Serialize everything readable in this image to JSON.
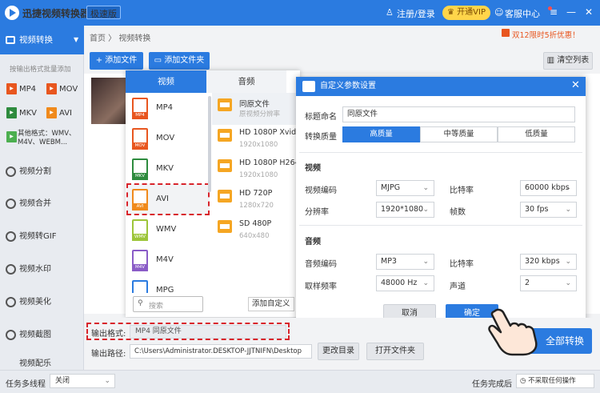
{
  "titlebar": {
    "app_name": "迅捷视频转换器",
    "badge": "极速版",
    "login": "注册/登录",
    "vip": "开通VIP",
    "service": "客服中心",
    "min": "—",
    "menu": "≡",
    "close": "✕"
  },
  "sidebar": {
    "header": "视频转换",
    "subtitle": "按输出格式批量添加",
    "formats": [
      "MP4",
      "MOV",
      "MKV",
      "AVI"
    ],
    "other_line1": "其他格式：WMV、",
    "other_line2": "M4V、WEBM...",
    "items": [
      "视频分割",
      "视频合并",
      "视频转GIF",
      "视频水印",
      "视频美化",
      "视频截图",
      "视频配乐"
    ]
  },
  "main": {
    "breadcrumb": "首页 〉 视频转换",
    "promo": "双12限时5折优惠！",
    "add_file": "添加文件",
    "add_folder": "添加文件夹",
    "clear_list": "清空列表",
    "output_format_label": "输出格式:",
    "output_format_value": "MP4   同原文件",
    "output_path_label": "输出路径:",
    "output_path_value": "C:\\Users\\Administrator.DESKTOP-JJTNIFN\\Desktop",
    "change_dir": "更改目录",
    "open_folder": "打开文件夹",
    "convert_all": "全部转换"
  },
  "format_panel": {
    "tabs": [
      "视频",
      "音频"
    ],
    "formats": [
      {
        "name": "MP4",
        "color": "#e8561f"
      },
      {
        "name": "MOV",
        "color": "#e8561f"
      },
      {
        "name": "MKV",
        "color": "#2e8b3e"
      },
      {
        "name": "AVI",
        "color": "#f08a1c"
      },
      {
        "name": "WMV",
        "color": "#9dc53a"
      },
      {
        "name": "M4V",
        "color": "#8a5cc7"
      },
      {
        "name": "MPG",
        "color": "#2b7be0"
      }
    ],
    "presets": [
      {
        "name": "同原文件",
        "sub": "原视频分辨率"
      },
      {
        "name": "HD 1080P Xvid",
        "sub": "1920x1080"
      },
      {
        "name": "HD 1080P H264",
        "sub": "1920x1080"
      },
      {
        "name": "HD 720P",
        "sub": "1280x720"
      },
      {
        "name": "SD 480P",
        "sub": "640x480"
      }
    ],
    "search_placeholder": "搜索",
    "add_custom": "添加自定义"
  },
  "dialog": {
    "title": "自定义参数设置",
    "title_name_label": "标题命名",
    "title_name_value": "同原文件",
    "quality_label": "转换质量",
    "quality_options": [
      "高质量",
      "中等质量",
      "低质量"
    ],
    "video_section": "视频",
    "video_codec_label": "视频编码",
    "video_codec": "MJPG",
    "video_bitrate_label": "比特率",
    "video_bitrate": "60000 kbps",
    "resolution_label": "分辨率",
    "resolution": "1920*1080",
    "fps_label": "帧数",
    "fps": "30 fps",
    "audio_section": "音频",
    "audio_codec_label": "音频编码",
    "audio_codec": "MP3",
    "audio_bitrate_label": "比特率",
    "audio_bitrate": "320 kbps",
    "sample_label": "取样频率",
    "sample": "48000 Hz",
    "channel_label": "声道",
    "channel": "2",
    "cancel": "取消",
    "ok": "确定"
  },
  "bottom": {
    "multithread_label": "任务多线程",
    "multithread_value": "关闭",
    "done_label": "任务完成后",
    "done_value": "不采取任何操作"
  },
  "colors": {
    "accent": "#2b7be0",
    "highlight": "#d8232a"
  }
}
